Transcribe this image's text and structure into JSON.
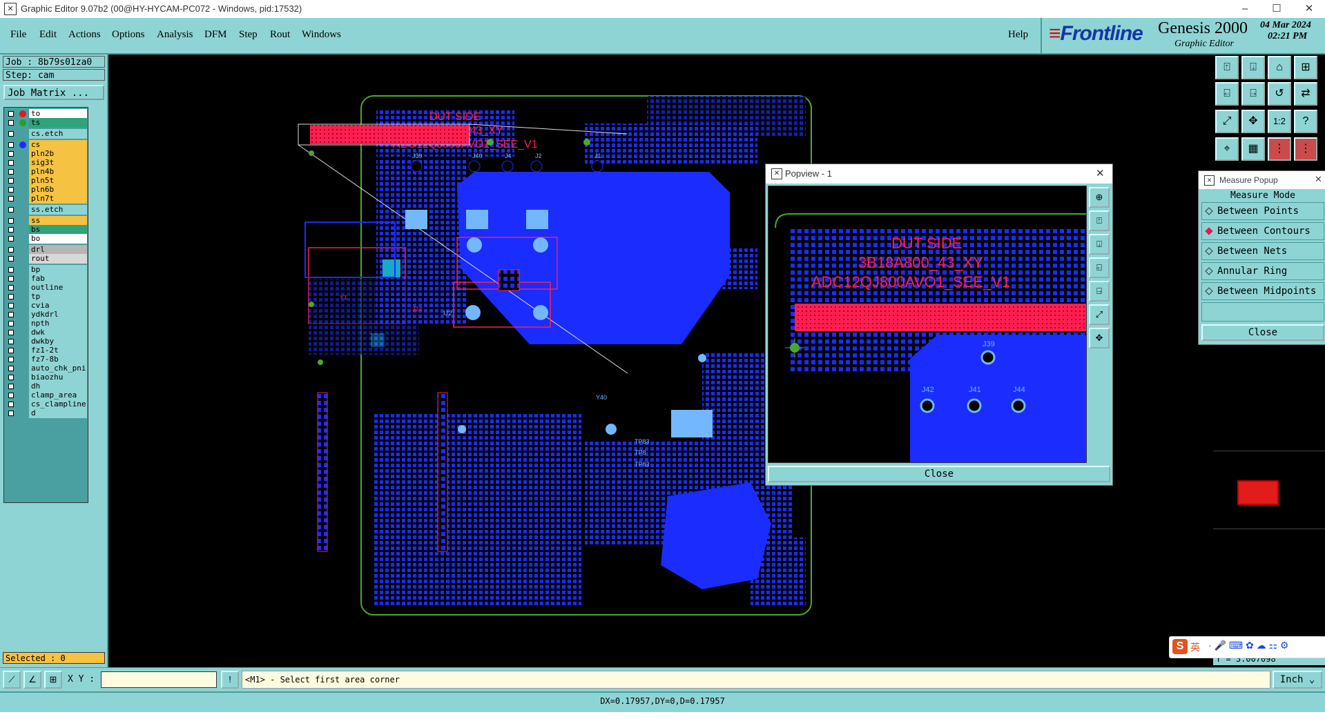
{
  "window": {
    "title": "Graphic Editor 9.07b2 (00@HY-HYCAM-PC072 - Windows, pid:17532)",
    "minimize": "–",
    "maximize": "☐",
    "close": "✕"
  },
  "menu": {
    "items": [
      "File",
      "Edit",
      "Actions",
      "Options",
      "Analysis",
      "DFM",
      "Step",
      "Rout",
      "Windows"
    ],
    "help": "Help"
  },
  "brand": {
    "logo": "Frontline",
    "product": "Genesis 2000",
    "subtitle": "Graphic Editor",
    "date": "04 Mar 2024",
    "time": "02:21 PM"
  },
  "left_panel": {
    "job": "Job : 8b79s01za0",
    "step": "Step: cam",
    "job_matrix": "Job Matrix ...",
    "selected": "Selected : 0"
  },
  "layers": [
    {
      "name": "to",
      "dot": "#e21b1b",
      "fill": "#ffffff"
    },
    {
      "name": "ts",
      "dot": "#1fa51f",
      "fill": "#2fa37c"
    },
    {
      "name": "cs.etch",
      "dot": "",
      "fill": "#8fd4d4"
    },
    {
      "name": "cs",
      "dot": "#1b2cff",
      "fill": "#f5c242"
    },
    {
      "name": "pln2b",
      "dot": "",
      "fill": "#f5c242"
    },
    {
      "name": "sig3t",
      "dot": "",
      "fill": "#f5c242"
    },
    {
      "name": "pln4b",
      "dot": "",
      "fill": "#f5c242"
    },
    {
      "name": "pln5t",
      "dot": "",
      "fill": "#f5c242"
    },
    {
      "name": "pln6b",
      "dot": "",
      "fill": "#f5c242"
    },
    {
      "name": "pln7t",
      "dot": "",
      "fill": "#f5c242"
    },
    {
      "name": "ss.etch",
      "dot": "",
      "fill": "#8fd4d4"
    },
    {
      "name": "ss",
      "dot": "",
      "fill": "#f5c242"
    },
    {
      "name": "bs",
      "dot": "",
      "fill": "#2fa37c"
    },
    {
      "name": "bo",
      "dot": "",
      "fill": "#ffffff"
    },
    {
      "name": "drl",
      "dot": "",
      "fill": "#b5b5b5"
    },
    {
      "name": "rout",
      "dot": "",
      "fill": "#d8d8d8"
    },
    {
      "name": "bp",
      "dot": "",
      "fill": "#8fd4d4"
    },
    {
      "name": "fab",
      "dot": "",
      "fill": "#8fd4d4"
    },
    {
      "name": "outline",
      "dot": "",
      "fill": "#8fd4d4"
    },
    {
      "name": "tp",
      "dot": "",
      "fill": "#8fd4d4"
    },
    {
      "name": "cvia",
      "dot": "",
      "fill": "#8fd4d4"
    },
    {
      "name": "ydkdrl",
      "dot": "",
      "fill": "#8fd4d4"
    },
    {
      "name": "npth",
      "dot": "",
      "fill": "#8fd4d4"
    },
    {
      "name": "dwk",
      "dot": "",
      "fill": "#8fd4d4"
    },
    {
      "name": "dwkby",
      "dot": "",
      "fill": "#8fd4d4"
    },
    {
      "name": "fz1-2t",
      "dot": "",
      "fill": "#8fd4d4"
    },
    {
      "name": "fz7-8b",
      "dot": "",
      "fill": "#8fd4d4"
    },
    {
      "name": "auto_chk_pni",
      "dot": "",
      "fill": "#8fd4d4"
    },
    {
      "name": "biaozhu",
      "dot": "",
      "fill": "#8fd4d4"
    },
    {
      "name": "dh",
      "dot": "",
      "fill": "#8fd4d4"
    },
    {
      "name": "clamp_area",
      "dot": "",
      "fill": "#8fd4d4"
    },
    {
      "name": "cs_clampline",
      "dot": "",
      "fill": "#8fd4d4"
    },
    {
      "name": "d",
      "dot": "",
      "fill": "#8fd4d4"
    }
  ],
  "board": {
    "text_lines": [
      "DUT SIDE",
      "3B18A800_43_XY",
      "ADC12QJ800AVO1_SEE_V1"
    ],
    "labels": [
      "J39",
      "J40",
      "J4",
      "J2",
      "J1",
      "J42",
      "J41",
      "J44",
      "J43",
      "J3",
      "J4",
      "J5",
      "Y1",
      "J24",
      "U2",
      "Y40",
      "TP83",
      "TP8",
      "TP83"
    ]
  },
  "popview": {
    "title": "Popview - 1",
    "close": "Close",
    "text_lines": [
      "DUT SIDE",
      "3B18A800_43_XY",
      "ADC12QJ800AVO1_SEE_V1"
    ],
    "labels": [
      "J39",
      "J42",
      "J41",
      "J44"
    ]
  },
  "measure": {
    "title": "Measure Popup",
    "mode_header": "Measure Mode",
    "options": [
      "Between Points",
      "Between Contours",
      "Between Nets",
      "Annular Ring",
      "Between Midpoints"
    ],
    "selected_index": 1,
    "close": "Close",
    "partial_readout": "Y = 3.007098"
  },
  "status": {
    "xy_label": "X Y :",
    "xy_value": "",
    "prompt": "<M1> - Select first area corner",
    "units": "Inch",
    "measurement": "DX=0.17957,DY=0,D=0.17957"
  },
  "ime": {
    "lang": "英"
  },
  "colors": {
    "panel": "#8fd4d4",
    "layer_yellow": "#f5c242",
    "board_blue": "#1b2cff",
    "board_red": "#ff1f4f",
    "board_green": "#4aa832"
  }
}
